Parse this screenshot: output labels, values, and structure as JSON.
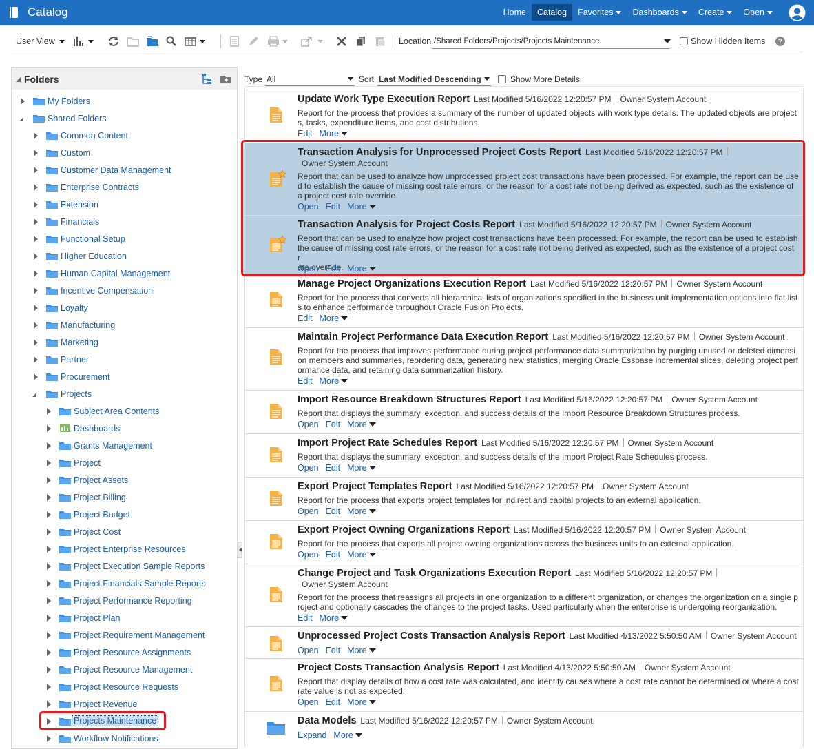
{
  "header": {
    "title": "Catalog",
    "nav": [
      {
        "label": "Home",
        "dropdown": false,
        "active": false
      },
      {
        "label": "Catalog",
        "dropdown": false,
        "active": true
      },
      {
        "label": "Favorites",
        "dropdown": true,
        "active": false
      },
      {
        "label": "Dashboards",
        "dropdown": true,
        "active": false
      },
      {
        "label": "Create",
        "dropdown": true,
        "active": false
      },
      {
        "label": "Open",
        "dropdown": true,
        "active": false
      }
    ]
  },
  "toolbar": {
    "user_view": "User View",
    "location_label": "Location",
    "location_value": "/Shared Folders/Projects/Projects Maintenance",
    "show_hidden": "Show Hidden Items",
    "help": "?"
  },
  "folders": {
    "title": "Folders",
    "tree": [
      {
        "label": "My Folders",
        "level": 0,
        "state": "closed",
        "icon": "folder"
      },
      {
        "label": "Shared Folders",
        "level": 0,
        "state": "open",
        "icon": "folder"
      },
      {
        "label": "Common Content",
        "level": 1,
        "state": "closed",
        "icon": "folder"
      },
      {
        "label": "Custom",
        "level": 1,
        "state": "closed",
        "icon": "folder"
      },
      {
        "label": "Customer Data Management",
        "level": 1,
        "state": "closed",
        "icon": "folder"
      },
      {
        "label": "Enterprise Contracts",
        "level": 1,
        "state": "closed",
        "icon": "folder"
      },
      {
        "label": "Extension",
        "level": 1,
        "state": "closed",
        "icon": "folder"
      },
      {
        "label": "Financials",
        "level": 1,
        "state": "closed",
        "icon": "folder"
      },
      {
        "label": "Functional Setup",
        "level": 1,
        "state": "closed",
        "icon": "folder"
      },
      {
        "label": "Higher Education",
        "level": 1,
        "state": "closed",
        "icon": "folder"
      },
      {
        "label": "Human Capital Management",
        "level": 1,
        "state": "closed",
        "icon": "folder"
      },
      {
        "label": "Incentive Compensation",
        "level": 1,
        "state": "closed",
        "icon": "folder"
      },
      {
        "label": "Loyalty",
        "level": 1,
        "state": "closed",
        "icon": "folder"
      },
      {
        "label": "Manufacturing",
        "level": 1,
        "state": "closed",
        "icon": "folder"
      },
      {
        "label": "Marketing",
        "level": 1,
        "state": "closed",
        "icon": "folder"
      },
      {
        "label": "Partner",
        "level": 1,
        "state": "closed",
        "icon": "folder"
      },
      {
        "label": "Procurement",
        "level": 1,
        "state": "closed",
        "icon": "folder"
      },
      {
        "label": "Projects",
        "level": 1,
        "state": "open",
        "icon": "folder"
      },
      {
        "label": "Subject Area Contents",
        "level": 2,
        "state": "closed",
        "icon": "folder"
      },
      {
        "label": "Dashboards",
        "level": 2,
        "state": "closed",
        "icon": "dashboard"
      },
      {
        "label": "Grants Management",
        "level": 2,
        "state": "closed",
        "icon": "folder"
      },
      {
        "label": "Project",
        "level": 2,
        "state": "closed",
        "icon": "folder"
      },
      {
        "label": "Project Assets",
        "level": 2,
        "state": "closed",
        "icon": "folder"
      },
      {
        "label": "Project Billing",
        "level": 2,
        "state": "closed",
        "icon": "folder"
      },
      {
        "label": "Project Budget",
        "level": 2,
        "state": "closed",
        "icon": "folder"
      },
      {
        "label": "Project Cost",
        "level": 2,
        "state": "closed",
        "icon": "folder"
      },
      {
        "label": "Project Enterprise Resources",
        "level": 2,
        "state": "closed",
        "icon": "folder"
      },
      {
        "label": "Project Execution Sample Reports",
        "level": 2,
        "state": "closed",
        "icon": "folder"
      },
      {
        "label": "Project Financials Sample Reports",
        "level": 2,
        "state": "closed",
        "icon": "folder"
      },
      {
        "label": "Project Performance Reporting",
        "level": 2,
        "state": "closed",
        "icon": "folder"
      },
      {
        "label": "Project Plan",
        "level": 2,
        "state": "closed",
        "icon": "folder"
      },
      {
        "label": "Project Requirement Management",
        "level": 2,
        "state": "closed",
        "icon": "folder"
      },
      {
        "label": "Project Resource Assignments",
        "level": 2,
        "state": "closed",
        "icon": "folder"
      },
      {
        "label": "Project Resource Management",
        "level": 2,
        "state": "closed",
        "icon": "folder"
      },
      {
        "label": "Project Resource Requests",
        "level": 2,
        "state": "closed",
        "icon": "folder"
      },
      {
        "label": "Project Revenue",
        "level": 2,
        "state": "closed",
        "icon": "folder"
      },
      {
        "label": "Projects Maintenance",
        "level": 2,
        "state": "closed",
        "icon": "folder",
        "selected": true
      },
      {
        "label": "Workflow Notifications",
        "level": 2,
        "state": "closed",
        "icon": "folder"
      }
    ]
  },
  "filter": {
    "type_label": "Type",
    "type_value": "All",
    "sort_label": "Sort",
    "sort_value": "Last Modified Descending",
    "show_more": "Show More Details"
  },
  "items": [
    {
      "name": "Update Work Type Execution Report",
      "modified": "Last Modified 5/16/2022 12:20:57 PM",
      "owner": "Owner System Account",
      "desc": [
        "Report for the process that provides a summary of the number of updated objects with work type details. The updated objects are project",
        "s, tasks, expenditure items, and cost distributions."
      ],
      "actions": [
        "Edit",
        "More"
      ],
      "icon": "report",
      "highlight": false
    },
    {
      "name": "Transaction Analysis for Unprocessed Project Costs Report",
      "modified": "Last Modified 5/16/2022 12:20:57 PM",
      "owner": "Owner System Account",
      "desc": [
        "Report that can be used to analyze how unprocessed project cost transactions have been processed. For example, the report can be use",
        "d to establish the cause of missing cost rate errors, or the reason for a cost rate not being derived as expected, such as the existence of",
        "a project cost rate override."
      ],
      "actions": [
        "Open",
        "Edit",
        "More"
      ],
      "icon": "report-star",
      "highlight": true
    },
    {
      "name": "Transaction Analysis for Project Costs Report",
      "modified": "Last Modified 5/16/2022 12:20:57 PM",
      "owner": "Owner System Account",
      "desc": [
        "Report that can be used to analyze how project cost transactions have been processed. For example, the report can be used to establish",
        "the cause of missing cost rate errors, or the reason for a cost rate not being derived as expected, such as the existence of a project cost r",
        "ate override."
      ],
      "actions": [
        "Open",
        "Edit",
        "More"
      ],
      "icon": "report-star",
      "highlight": true
    },
    {
      "name": "Manage Project Organizations Execution Report",
      "modified": "Last Modified 5/16/2022 12:20:57 PM",
      "owner": "Owner System Account",
      "desc": [
        "Report for the process that converts all hierarchical lists of organizations specified in the business unit implementation options into flat list",
        "s to enhance performance throughout Oracle Fusion Projects."
      ],
      "actions": [
        "Edit",
        "More"
      ],
      "icon": "report",
      "highlight": false
    },
    {
      "name": "Maintain Project Performance Data Execution Report",
      "modified": "Last Modified 5/16/2022 12:20:57 PM",
      "owner": "Owner System Account",
      "desc": [
        "Report for the process that improves performance during project performance data summarization by purging unused or deleted dimensi",
        "on members and summaries, reordering data, generating new statistics, merging Oracle Essbase incremental slices, deleting project perf",
        "ormance data, and retaining data summarization history."
      ],
      "actions": [
        "Edit",
        "More"
      ],
      "icon": "report",
      "highlight": false
    },
    {
      "name": "Import Resource Breakdown Structures Report",
      "modified": "Last Modified 5/16/2022 12:20:57 PM",
      "owner": "Owner System Account",
      "desc": [
        "Report that displays the summary, exception, and success details of the Import Resource Breakdown Structures process."
      ],
      "actions": [
        "Open",
        "Edit",
        "More"
      ],
      "icon": "report",
      "highlight": false
    },
    {
      "name": "Import Project Rate Schedules Report",
      "modified": "Last Modified 5/16/2022 12:20:57 PM",
      "owner": "Owner System Account",
      "desc": [
        "Report that displays the summary, exception, and success details of the Import Project Rate Schedules process."
      ],
      "actions": [
        "Open",
        "Edit",
        "More"
      ],
      "icon": "report",
      "highlight": false
    },
    {
      "name": "Export Project Templates Report",
      "modified": "Last Modified 5/16/2022 12:20:57 PM",
      "owner": "Owner System Account",
      "desc": [
        "Report for the process that exports project templates for indirect and capital projects to an external application."
      ],
      "actions": [
        "Open",
        "Edit",
        "More"
      ],
      "icon": "report",
      "highlight": false
    },
    {
      "name": "Export Project Owning Organizations Report",
      "modified": "Last Modified 5/16/2022 12:20:57 PM",
      "owner": "Owner System Account",
      "desc": [
        "Report for the process that exports all project owning organizations across the business units to an external application."
      ],
      "actions": [
        "Open",
        "Edit",
        "More"
      ],
      "icon": "report",
      "highlight": false
    },
    {
      "name": "Change Project and Task Organizations Execution Report",
      "modified": "Last Modified 5/16/2022 12:20:57 PM",
      "owner": "Owner System Account",
      "desc": [
        "Report for the process that reassigns all projects in one organization to a different organization, or changes the organization on a single p",
        "roject and optionally cascades the changes to the project tasks. Used particularly when the enterprise is undergoing reorganization."
      ],
      "actions": [
        "Edit",
        "More"
      ],
      "icon": "report",
      "highlight": false
    },
    {
      "name": "Unprocessed Project Costs Transaction Analysis Report",
      "modified": "Last Modified 4/13/2022 5:50:50 AM",
      "owner": "Owner System Account",
      "desc": [],
      "actions": [
        "Open",
        "Edit",
        "More"
      ],
      "icon": "report",
      "highlight": false
    },
    {
      "name": "Project Costs Transaction Analysis Report",
      "modified": "Last Modified 4/13/2022 5:50:50 AM",
      "owner": "Owner System Account",
      "desc": [
        "Report that display details of how a cost rate was calculated, and identify causes where a cost rate cannot be determined or where a cost",
        "rate value is not as expected."
      ],
      "actions": [
        "Open",
        "Edit",
        "More"
      ],
      "icon": "report",
      "highlight": false
    },
    {
      "name": "Data Models",
      "modified": "Last Modified 5/16/2022 12:20:57 PM",
      "owner": "Owner System Account",
      "desc": [],
      "actions": [
        "Expand",
        "More"
      ],
      "icon": "folder",
      "highlight": false
    }
  ]
}
